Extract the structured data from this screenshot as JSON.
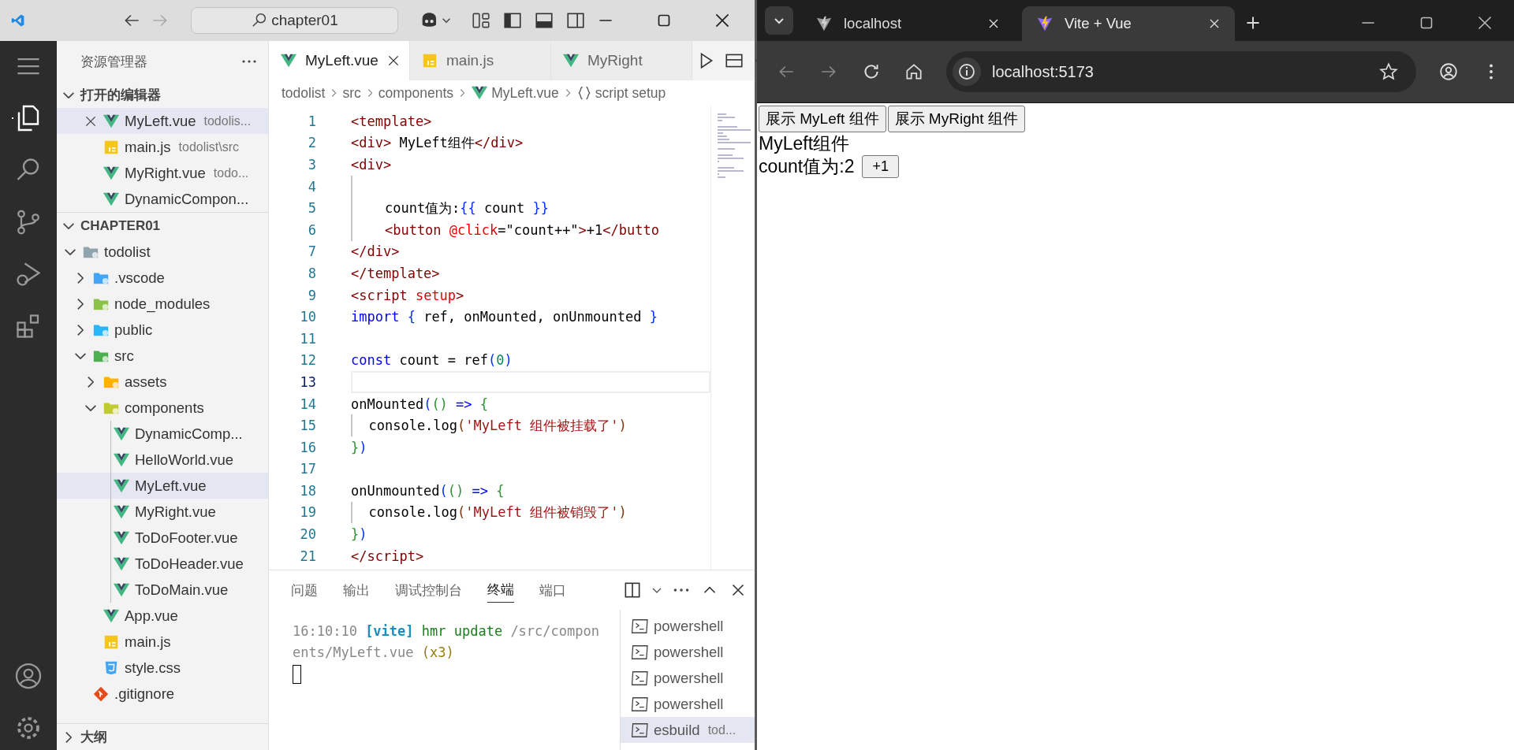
{
  "vscode": {
    "title_bar": {
      "search": "chapter01"
    },
    "explorer": {
      "title": "资源管理器",
      "open_editors": {
        "title": "打开的编辑器",
        "expanded": true,
        "items": [
          {
            "name": "MyLeft.vue",
            "path": "todolis...",
            "kind": "vue",
            "selected": true
          },
          {
            "name": "main.js",
            "path": "todolist\\src",
            "kind": "js",
            "selected": false
          },
          {
            "name": "MyRight.vue",
            "path": "todo...",
            "kind": "vue",
            "selected": false
          },
          {
            "name": "DynamicCompon...",
            "kind": "vue",
            "selected": false
          }
        ]
      },
      "workspace": {
        "title": "CHAPTER01",
        "expanded": true,
        "tree": [
          {
            "name": "todolist",
            "kind": "folder",
            "expanded": true,
            "selected": false,
            "children": [
              {
                "name": ".vscode",
                "kind": "folder-vscode",
                "expanded": false,
                "selected": false
              },
              {
                "name": "node_modules",
                "kind": "folder-node",
                "expanded": false,
                "selected": false
              },
              {
                "name": "public",
                "kind": "folder-public",
                "expanded": false,
                "selected": false
              },
              {
                "name": "src",
                "kind": "folder-src",
                "expanded": true,
                "selected": false,
                "children": [
                  {
                    "name": "assets",
                    "kind": "folder-assets",
                    "expanded": false,
                    "selected": false
                  },
                  {
                    "name": "components",
                    "kind": "folder-components",
                    "expanded": true,
                    "selected": false,
                    "children": [
                      {
                        "name": "DynamicComp...",
                        "kind": "vue",
                        "selected": false
                      },
                      {
                        "name": "HelloWorld.vue",
                        "kind": "vue",
                        "selected": false
                      },
                      {
                        "name": "MyLeft.vue",
                        "kind": "vue",
                        "selected": true
                      },
                      {
                        "name": "MyRight.vue",
                        "kind": "vue",
                        "selected": false
                      },
                      {
                        "name": "ToDoFooter.vue",
                        "kind": "vue",
                        "selected": false
                      },
                      {
                        "name": "ToDoHeader.vue",
                        "kind": "vue",
                        "selected": false
                      },
                      {
                        "name": "ToDoMain.vue",
                        "kind": "vue",
                        "selected": false
                      }
                    ]
                  },
                  {
                    "name": "App.vue",
                    "kind": "vue",
                    "selected": false
                  },
                  {
                    "name": "main.js",
                    "kind": "js",
                    "selected": false
                  },
                  {
                    "name": "style.css",
                    "kind": "css",
                    "selected": false
                  }
                ]
              },
              {
                "name": ".gitignore",
                "kind": "git",
                "selected": false
              }
            ]
          }
        ]
      },
      "outline": {
        "title": "大纲",
        "expanded": false
      }
    },
    "editor_tabs": [
      {
        "name": "MyLeft.vue",
        "kind": "vue",
        "selected": true
      },
      {
        "name": "main.js",
        "kind": "js",
        "selected": false
      },
      {
        "name": "MyRight",
        "kind": "vue",
        "selected": false
      }
    ],
    "breadcrumb": [
      {
        "text": "todolist"
      },
      {
        "text": "src"
      },
      {
        "text": "components"
      },
      {
        "text": "MyLeft.vue",
        "kind": "vue"
      },
      {
        "text": "script setup",
        "kind": "braces"
      }
    ],
    "code": [
      {
        "number": "1",
        "active": false,
        "indent_guide": false,
        "tokens": [
          {
            "kind": "tag",
            "text": "<template>"
          }
        ]
      },
      {
        "number": "2",
        "active": false,
        "indent_guide": false,
        "tokens": [
          {
            "kind": "tag",
            "text": "<div>"
          },
          {
            "kind": "text",
            "text": " MyLeft组件"
          },
          {
            "kind": "tag",
            "text": "</div>"
          }
        ]
      },
      {
        "number": "3",
        "active": false,
        "indent_guide": false,
        "tokens": [
          {
            "kind": "tag",
            "text": "<div>"
          }
        ]
      },
      {
        "number": "4",
        "active": false,
        "indent_guide": true
      },
      {
        "number": "5",
        "active": false,
        "indent_guide": true,
        "tokens": [
          {
            "kind": "text",
            "text": "    count值为:"
          },
          {
            "kind": "bracket",
            "text": "{{"
          },
          {
            "kind": "text",
            "text": " count "
          },
          {
            "kind": "bracket",
            "text": "}}"
          }
        ]
      },
      {
        "number": "6",
        "active": false,
        "indent_guide": true,
        "tokens": [
          {
            "kind": "tag",
            "text": "    <button "
          },
          {
            "kind": "attr",
            "text": "@click"
          },
          {
            "kind": "text",
            "text": "=\"count++\""
          },
          {
            "kind": "tag",
            "text": ">"
          },
          {
            "kind": "text",
            "text": "+1"
          },
          {
            "kind": "tag",
            "text": "</butto"
          }
        ]
      },
      {
        "number": "7",
        "active": false,
        "indent_guide": false,
        "tokens": [
          {
            "kind": "tag",
            "text": "</div>"
          }
        ]
      },
      {
        "number": "8",
        "active": false,
        "indent_guide": false,
        "tokens": [
          {
            "kind": "tag",
            "text": "</template>"
          }
        ]
      },
      {
        "number": "9",
        "active": false,
        "indent_guide": false,
        "tokens": [
          {
            "kind": "tag",
            "text": "<script "
          },
          {
            "kind": "attr",
            "text": "setup"
          },
          {
            "kind": "tag",
            "text": ">"
          }
        ]
      },
      {
        "number": "10",
        "active": false,
        "indent_guide": false,
        "tokens": [
          {
            "kind": "keyword",
            "text": "import "
          },
          {
            "kind": "bracket",
            "text": "{"
          },
          {
            "kind": "text",
            "text": " ref, onMounted, onUnmounted "
          },
          {
            "kind": "bracket",
            "text": "}"
          }
        ]
      },
      {
        "number": "11",
        "active": false,
        "indent_guide": false
      },
      {
        "number": "12",
        "active": false,
        "indent_guide": false,
        "tokens": [
          {
            "kind": "keyword",
            "text": "const"
          },
          {
            "kind": "text",
            "text": " count = ref"
          },
          {
            "kind": "bracket",
            "text": "("
          },
          {
            "kind": "number",
            "text": "0"
          },
          {
            "kind": "bracket",
            "text": ")"
          }
        ]
      },
      {
        "number": "13",
        "active": true,
        "indent_guide": false
      },
      {
        "number": "14",
        "active": false,
        "indent_guide": false,
        "tokens": [
          {
            "kind": "text",
            "text": "onMounted"
          },
          {
            "kind": "bracket",
            "text": "("
          },
          {
            "kind": "bracket2",
            "text": "()"
          },
          {
            "kind": "keyword",
            "text": " => "
          },
          {
            "kind": "bracket2",
            "text": "{"
          }
        ]
      },
      {
        "number": "15",
        "active": false,
        "indent_guide": true,
        "tokens": [
          {
            "kind": "text",
            "text": "  console.log"
          },
          {
            "kind": "bracket3",
            "text": "("
          },
          {
            "kind": "string",
            "text": "'MyLeft 组件被挂载了'"
          },
          {
            "kind": "bracket3",
            "text": ")"
          }
        ]
      },
      {
        "number": "16",
        "active": false,
        "indent_guide": false,
        "tokens": [
          {
            "kind": "bracket2",
            "text": "}"
          },
          {
            "kind": "bracket",
            "text": ")"
          }
        ]
      },
      {
        "number": "17",
        "active": false,
        "indent_guide": false
      },
      {
        "number": "18",
        "active": false,
        "indent_guide": false,
        "tokens": [
          {
            "kind": "text",
            "text": "onUnmounted"
          },
          {
            "kind": "bracket",
            "text": "("
          },
          {
            "kind": "bracket2",
            "text": "()"
          },
          {
            "kind": "keyword",
            "text": " => "
          },
          {
            "kind": "bracket2",
            "text": "{"
          }
        ]
      },
      {
        "number": "19",
        "active": false,
        "indent_guide": true,
        "tokens": [
          {
            "kind": "text",
            "text": "  console.log"
          },
          {
            "kind": "bracket3",
            "text": "("
          },
          {
            "kind": "string",
            "text": "'MyLeft 组件被销毁了'"
          },
          {
            "kind": "bracket3",
            "text": ")"
          }
        ]
      },
      {
        "number": "20",
        "active": false,
        "indent_guide": false,
        "tokens": [
          {
            "kind": "bracket2",
            "text": "}"
          },
          {
            "kind": "bracket",
            "text": ")"
          }
        ]
      },
      {
        "number": "21",
        "active": false,
        "indent_guide": false,
        "tokens": [
          {
            "kind": "tag",
            "text": "</script>"
          }
        ]
      }
    ],
    "panel": {
      "tabs": [
        {
          "label": "问题",
          "selected": false
        },
        {
          "label": "输出",
          "selected": false
        },
        {
          "label": "调试控制台",
          "selected": false
        },
        {
          "label": "终端",
          "selected": true
        },
        {
          "label": "端口",
          "selected": false
        }
      ],
      "terminal_output": [
        {
          "kind": "dim",
          "text": "16:10:10 "
        },
        {
          "kind": "source",
          "text": "[vite]"
        },
        {
          "kind": "ok",
          "text": " hmr update"
        },
        {
          "kind": "dim",
          "text": " /src/components/MyLeft.vue"
        },
        {
          "kind": "count",
          "text": " (x3)"
        }
      ],
      "terminals": [
        {
          "name": "powershell",
          "selected": false
        },
        {
          "name": "powershell",
          "selected": false
        },
        {
          "name": "powershell",
          "selected": false
        },
        {
          "name": "powershell",
          "selected": false
        },
        {
          "name": "esbuild",
          "detail": "tod...",
          "selected": true
        }
      ]
    }
  },
  "browser": {
    "tabs": [
      {
        "title": "localhost",
        "kind": "vite-gray",
        "selected": false
      },
      {
        "title": "Vite + Vue",
        "kind": "vite",
        "selected": true
      }
    ],
    "address": "localhost:5173",
    "page": {
      "buttons": [
        "展示 MyLeft 组件",
        "展示 MyRight 组件"
      ],
      "heading": "MyLeft组件",
      "count_label": "count值为:2",
      "increment_button": "+1"
    }
  }
}
